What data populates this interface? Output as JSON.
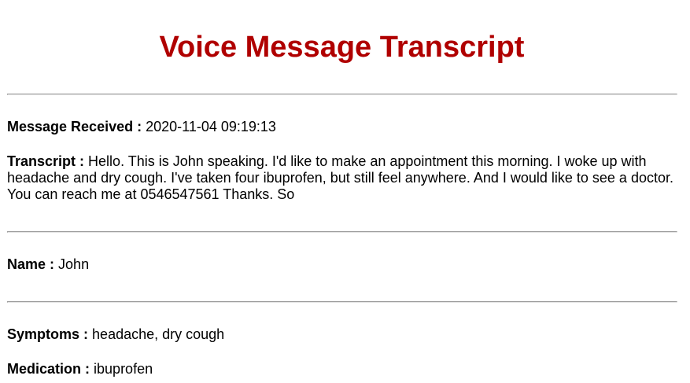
{
  "title": "Voice Message Transcript",
  "title_color": "#b00000",
  "fields": {
    "received": {
      "label": "Message Received :",
      "value": "2020-11-04 09:19:13"
    },
    "transcript": {
      "label": "Transcript :",
      "value": "Hello. This is John speaking. I'd like to make an appointment this morning. I woke up with headache and dry cough. I've taken four ibuprofen, but still feel anywhere. And I would like to see a doctor. You can reach me at 0546547561 Thanks. So"
    },
    "name": {
      "label": "Name :",
      "value": "John"
    },
    "symptoms": {
      "label": "Symptoms :",
      "value": "headache, dry cough"
    },
    "medication": {
      "label": "Medication :",
      "value": "ibuprofen"
    }
  }
}
